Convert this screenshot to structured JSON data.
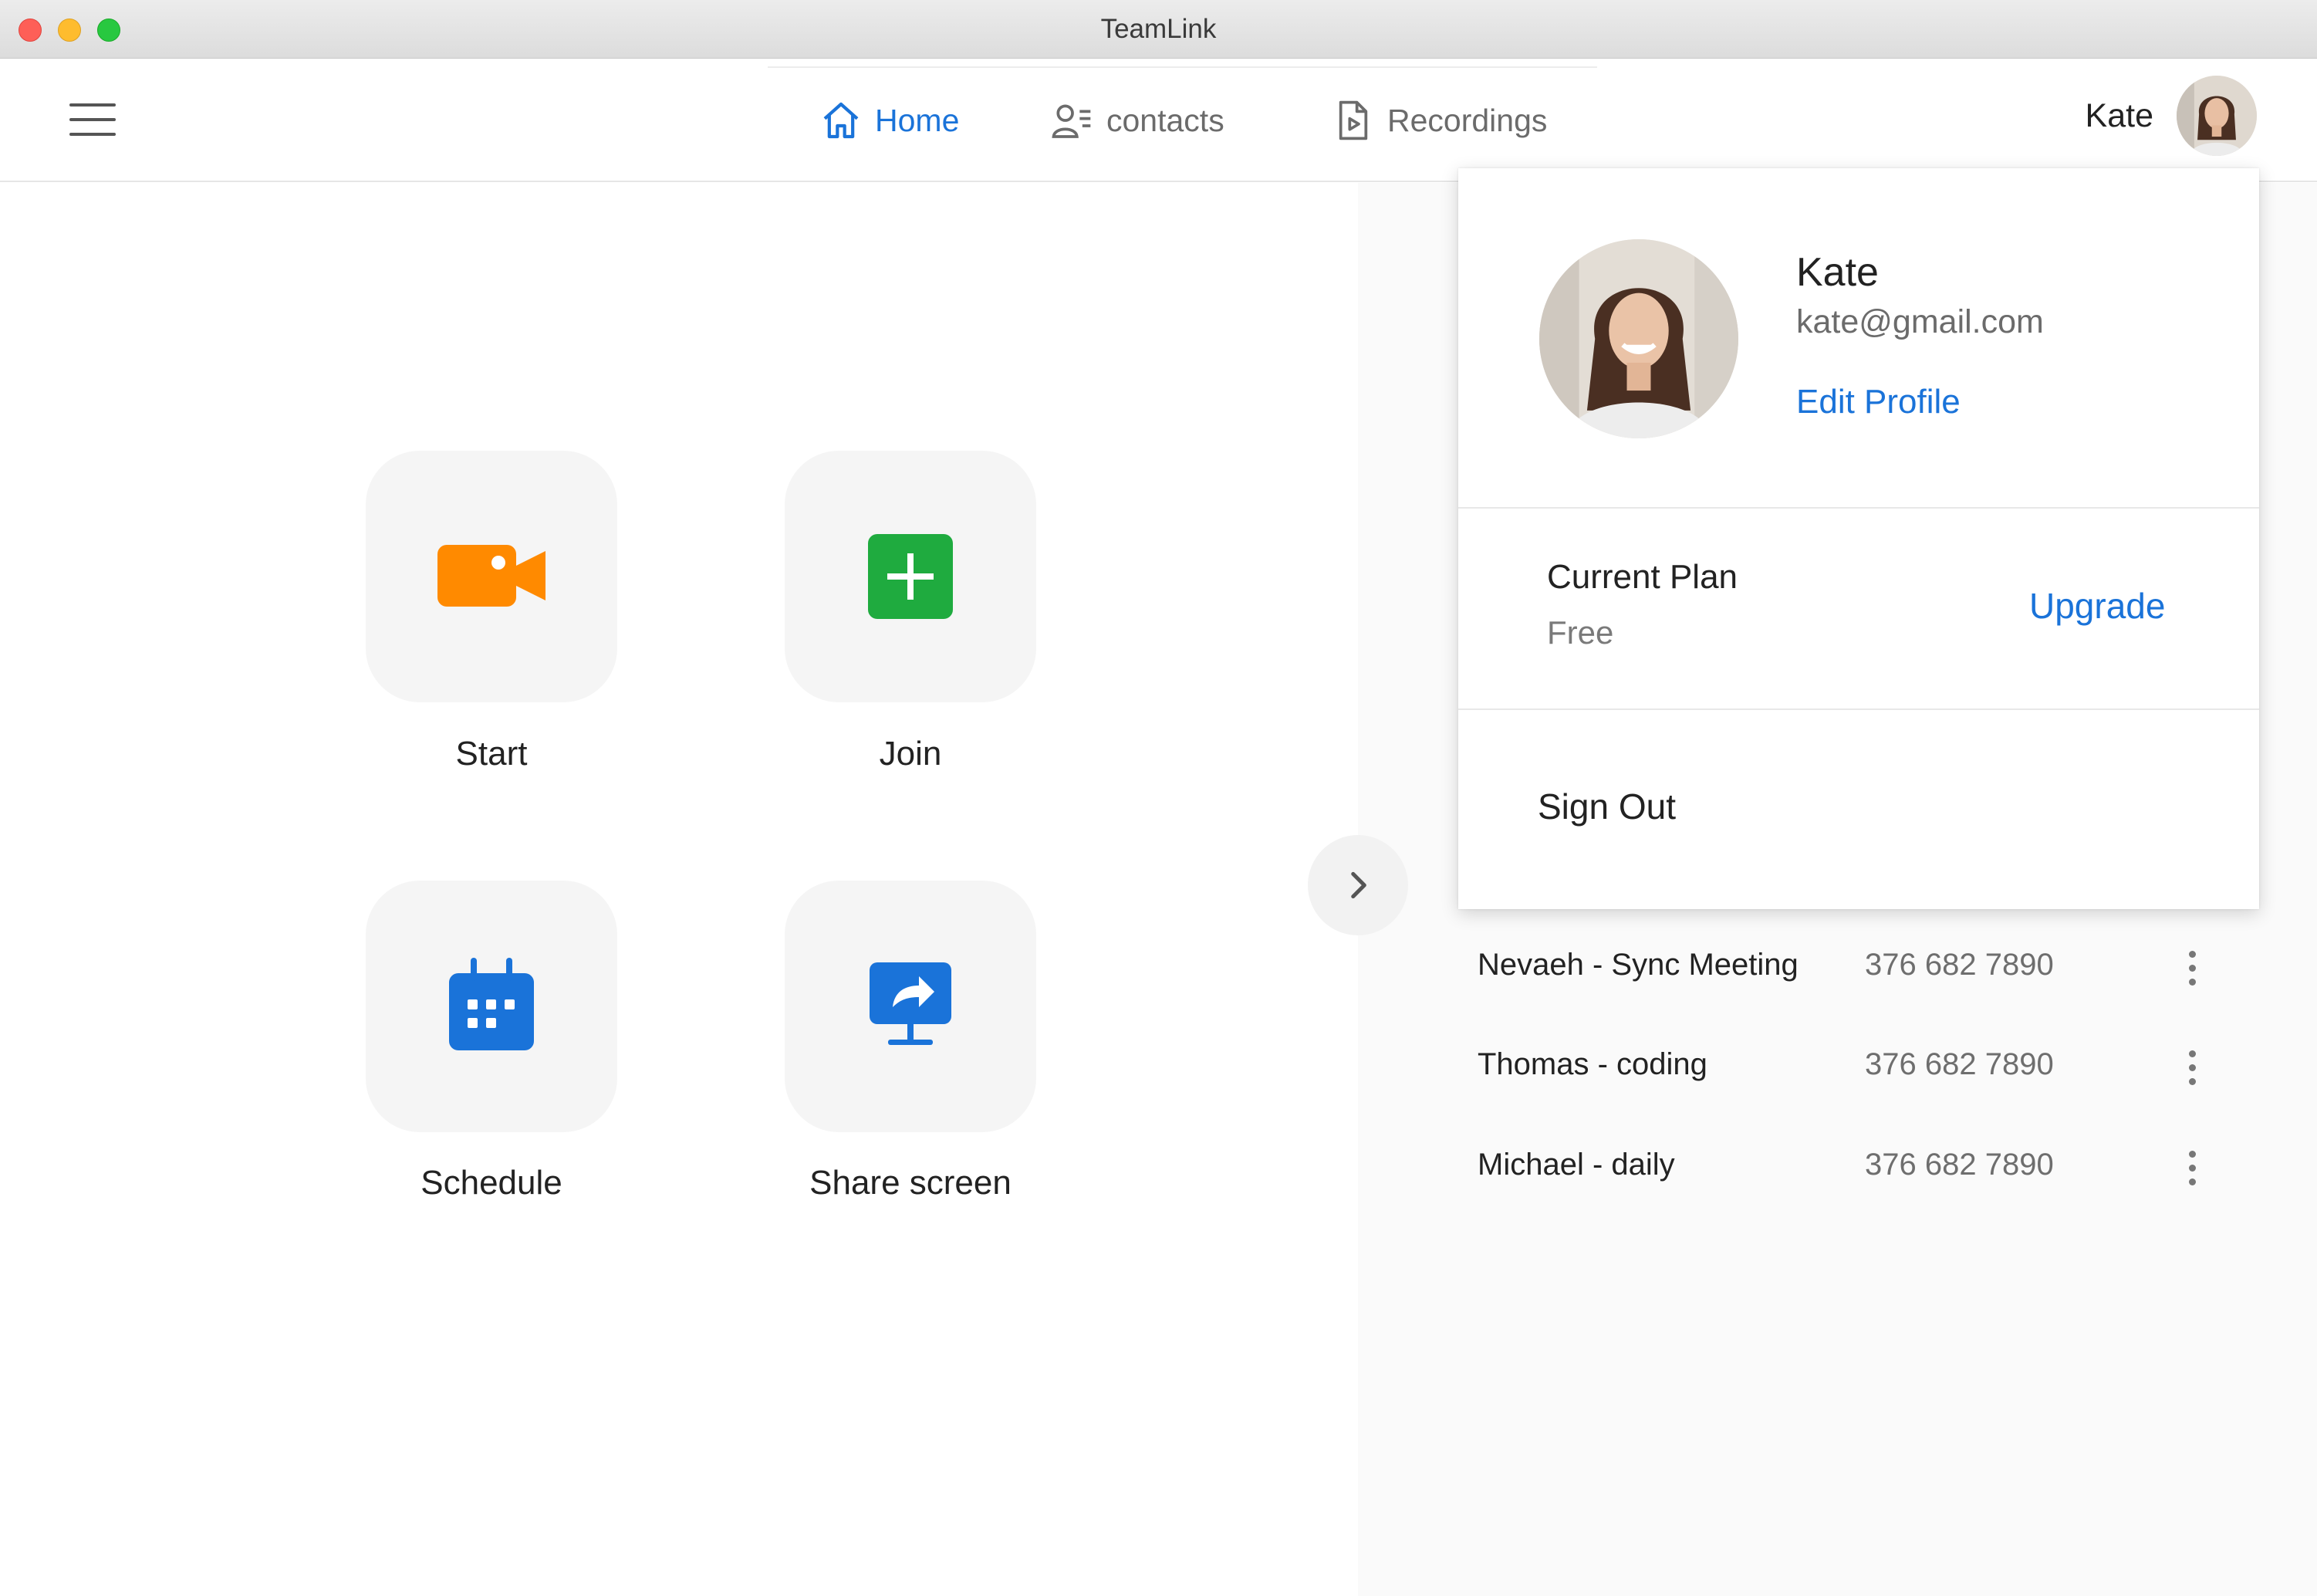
{
  "window": {
    "title": "TeamLink"
  },
  "nav": {
    "tabs": [
      {
        "label": "Home",
        "icon": "home-icon",
        "active": true
      },
      {
        "label": "contacts",
        "icon": "contacts-icon",
        "active": false
      },
      {
        "label": "Recordings",
        "icon": "recordings-icon",
        "active": false
      }
    ]
  },
  "user": {
    "name": "Kate"
  },
  "actions": [
    {
      "label": "Start",
      "icon": "video-camera-icon",
      "color": "#ff8a00"
    },
    {
      "label": "Join",
      "icon": "plus-icon",
      "color": "#1fab3f"
    },
    {
      "label": "Schedule",
      "icon": "calendar-icon",
      "color": "#1a73d9"
    },
    {
      "label": "Share screen",
      "icon": "share-screen-icon",
      "color": "#1a73d9"
    }
  ],
  "meetings": [
    {
      "name": "Nevaeh - Sync Meeting",
      "id": "376 682 7890"
    },
    {
      "name": "Thomas - coding",
      "id": "376 682 7890"
    },
    {
      "name": "Michael - daily",
      "id": "376 682 7890"
    }
  ],
  "profile_menu": {
    "name": "Kate",
    "email": "kate@gmail.com",
    "edit_label": "Edit Profile",
    "plan_label": "Current Plan",
    "plan_value": "Free",
    "upgrade_label": "Upgrade",
    "signout_label": "Sign Out"
  },
  "colors": {
    "accent": "#1a73d9",
    "start": "#ff8a00",
    "join": "#1fab3f"
  }
}
